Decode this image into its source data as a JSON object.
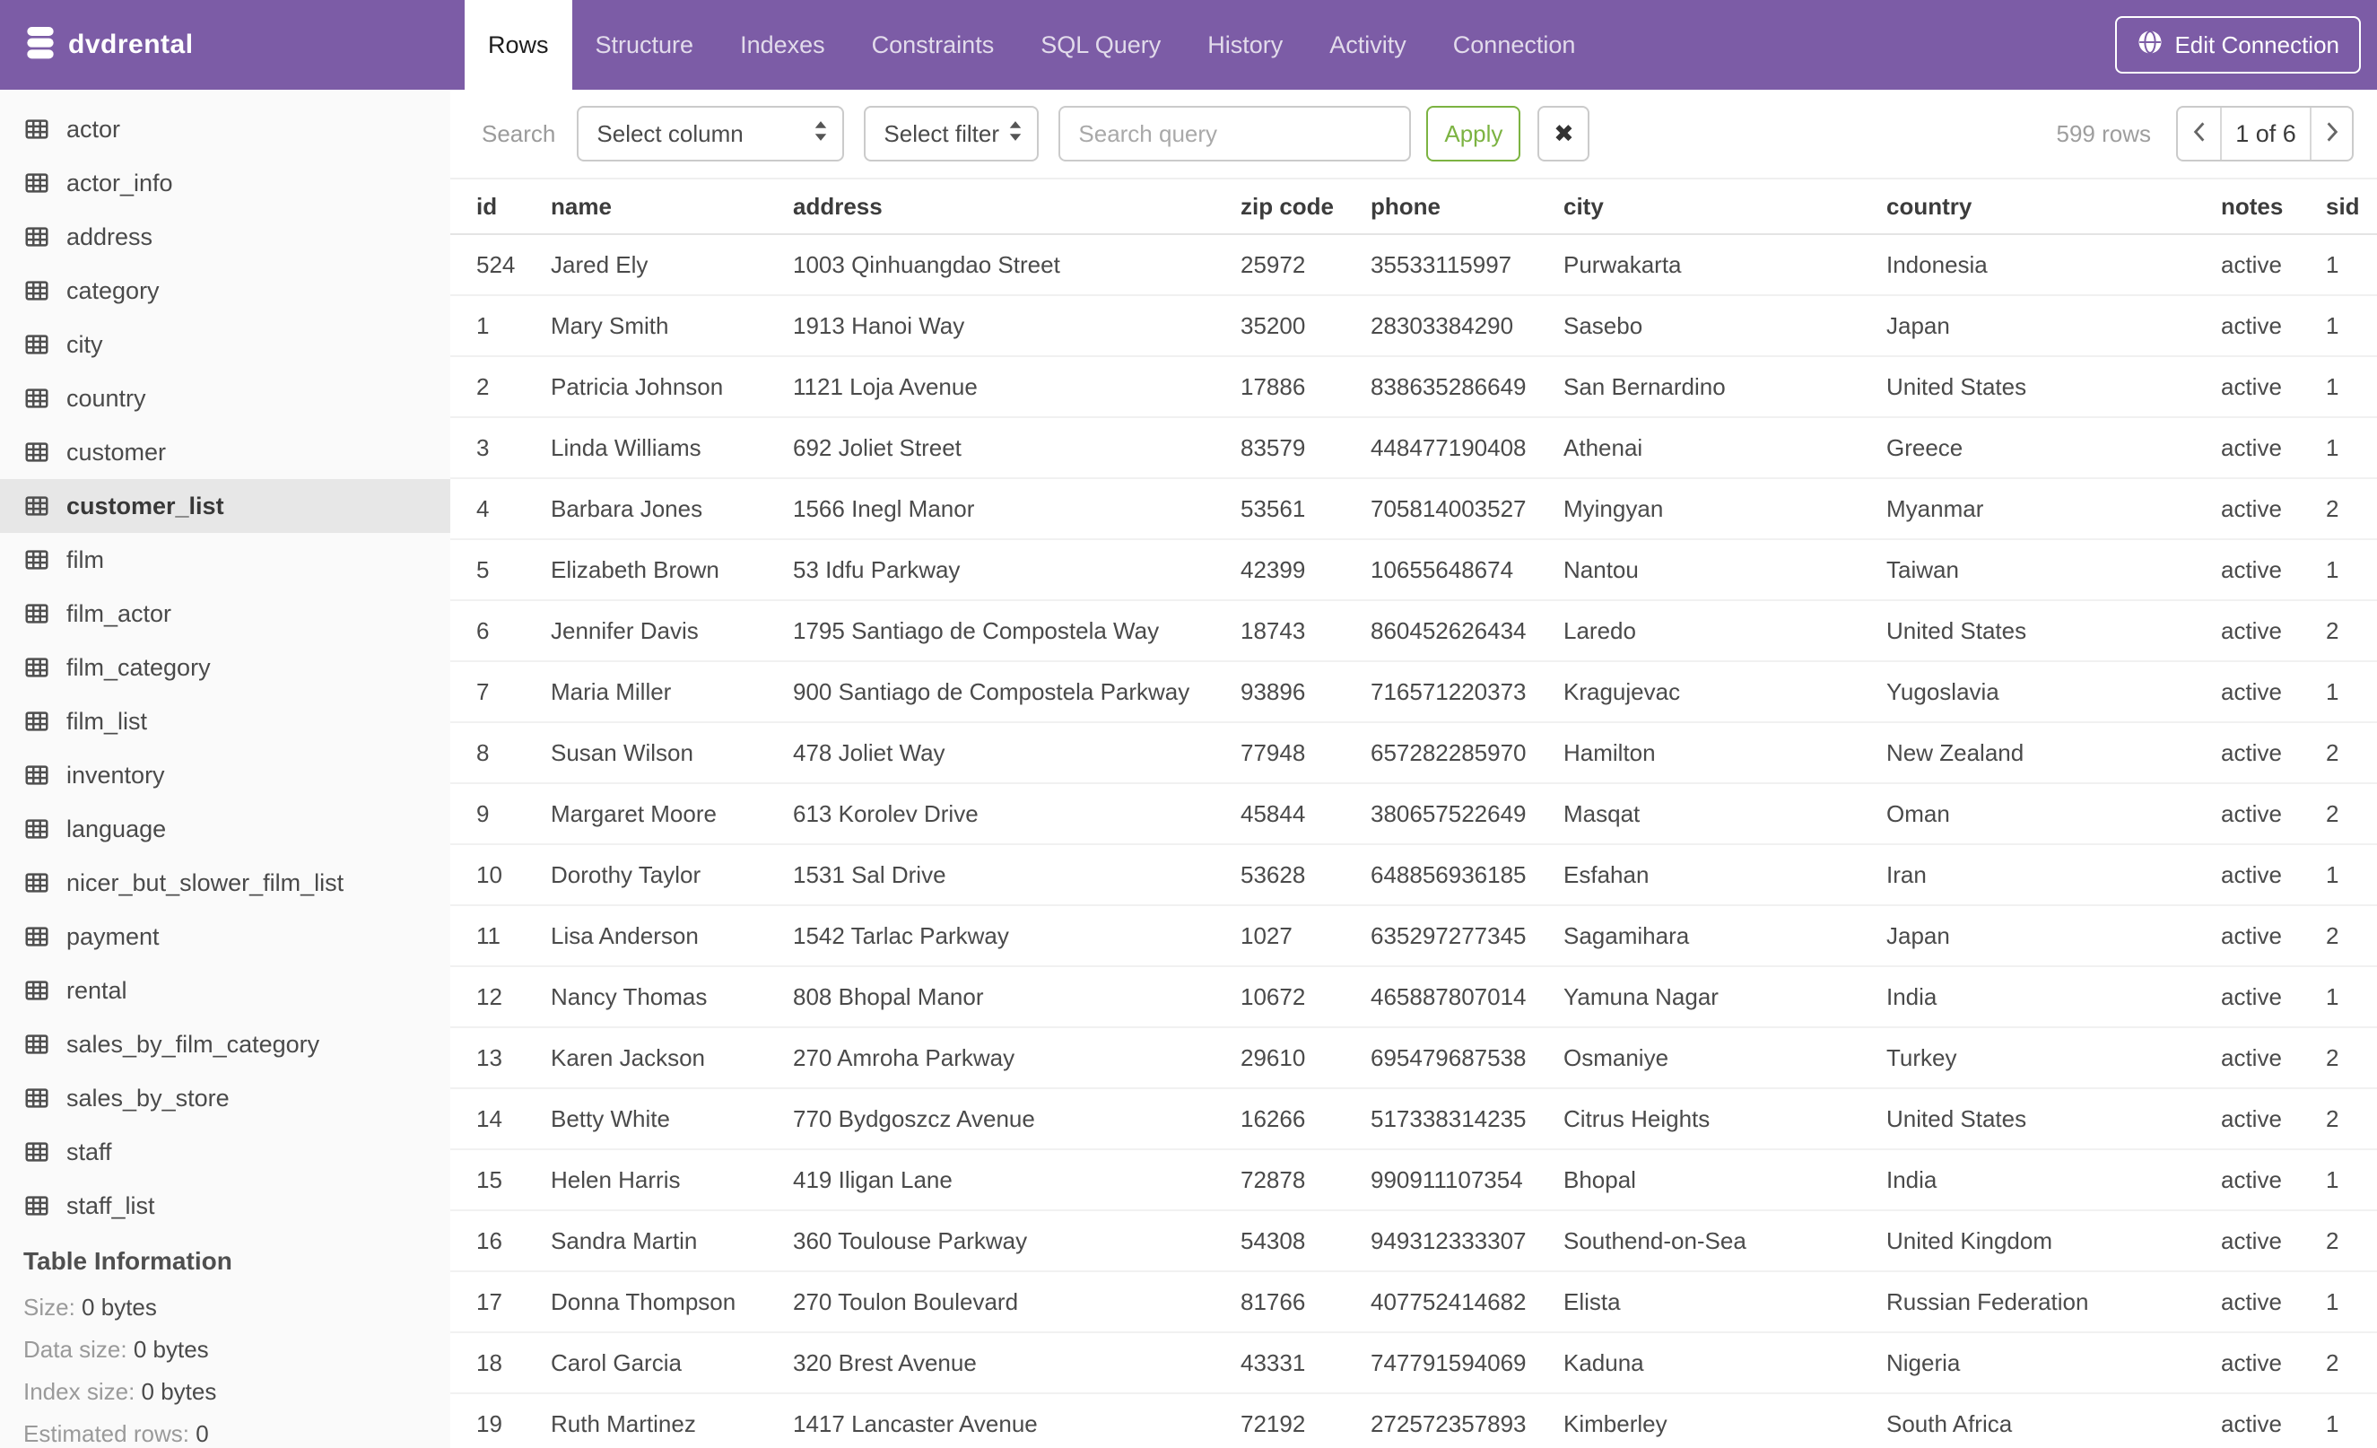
{
  "header": {
    "app_title": "dvdrental",
    "brand_icon": "database-icon",
    "tabs": [
      {
        "label": "Rows",
        "active": true
      },
      {
        "label": "Structure",
        "active": false
      },
      {
        "label": "Indexes",
        "active": false
      },
      {
        "label": "Constraints",
        "active": false
      },
      {
        "label": "SQL Query",
        "active": false
      },
      {
        "label": "History",
        "active": false
      },
      {
        "label": "Activity",
        "active": false
      },
      {
        "label": "Connection",
        "active": false
      }
    ],
    "edit_connection": {
      "label": "Edit Connection",
      "icon": "globe-icon"
    }
  },
  "toolbar": {
    "search_label": "Search",
    "column_select_value": "Select column",
    "column_select_icon": "updown-arrows-icon",
    "filter_select_value": "Select filter",
    "filter_select_icon": "updown-arrows-icon",
    "query_placeholder": "Search query",
    "apply_label": "Apply",
    "clear_label": "✖",
    "rows_count": "599 rows",
    "pagination": {
      "prev_icon": "chevron-left-icon",
      "current_page_label": "1 of 6",
      "next_icon": "chevron-right-icon"
    }
  },
  "sidebar": {
    "item_icon": "table-grid-icon",
    "tables": [
      "actor",
      "actor_info",
      "address",
      "category",
      "city",
      "country",
      "customer",
      "customer_list",
      "film",
      "film_actor",
      "film_category",
      "film_list",
      "inventory",
      "language",
      "nicer_but_slower_film_list",
      "payment",
      "rental",
      "sales_by_film_category",
      "sales_by_store",
      "staff",
      "staff_list"
    ],
    "selected": "customer_list",
    "table_information": {
      "title": "Table Information",
      "rows": [
        {
          "label": "Size:",
          "value": "0 bytes"
        },
        {
          "label": "Data size:",
          "value": "0 bytes"
        },
        {
          "label": "Index size:",
          "value": "0 bytes"
        },
        {
          "label": "Estimated rows:",
          "value": "0"
        }
      ]
    }
  },
  "table": {
    "columns": [
      "id",
      "name",
      "address",
      "zip code",
      "phone",
      "city",
      "country",
      "notes",
      "sid"
    ],
    "rows": [
      [
        524,
        "Jared Ely",
        "1003 Qinhuangdao Street",
        "25972",
        "35533115997",
        "Purwakarta",
        "Indonesia",
        "active",
        1
      ],
      [
        1,
        "Mary Smith",
        "1913 Hanoi Way",
        "35200",
        "28303384290",
        "Sasebo",
        "Japan",
        "active",
        1
      ],
      [
        2,
        "Patricia Johnson",
        "1121 Loja Avenue",
        "17886",
        "838635286649",
        "San Bernardino",
        "United States",
        "active",
        1
      ],
      [
        3,
        "Linda Williams",
        "692 Joliet Street",
        "83579",
        "448477190408",
        "Athenai",
        "Greece",
        "active",
        1
      ],
      [
        4,
        "Barbara Jones",
        "1566 Inegl Manor",
        "53561",
        "705814003527",
        "Myingyan",
        "Myanmar",
        "active",
        2
      ],
      [
        5,
        "Elizabeth Brown",
        "53 Idfu Parkway",
        "42399",
        "10655648674",
        "Nantou",
        "Taiwan",
        "active",
        1
      ],
      [
        6,
        "Jennifer Davis",
        "1795 Santiago de Compostela Way",
        "18743",
        "860452626434",
        "Laredo",
        "United States",
        "active",
        2
      ],
      [
        7,
        "Maria Miller",
        "900 Santiago de Compostela Parkway",
        "93896",
        "716571220373",
        "Kragujevac",
        "Yugoslavia",
        "active",
        1
      ],
      [
        8,
        "Susan Wilson",
        "478 Joliet Way",
        "77948",
        "657282285970",
        "Hamilton",
        "New Zealand",
        "active",
        2
      ],
      [
        9,
        "Margaret Moore",
        "613 Korolev Drive",
        "45844",
        "380657522649",
        "Masqat",
        "Oman",
        "active",
        2
      ],
      [
        10,
        "Dorothy Taylor",
        "1531 Sal Drive",
        "53628",
        "648856936185",
        "Esfahan",
        "Iran",
        "active",
        1
      ],
      [
        11,
        "Lisa Anderson",
        "1542 Tarlac Parkway",
        "1027",
        "635297277345",
        "Sagamihara",
        "Japan",
        "active",
        2
      ],
      [
        12,
        "Nancy Thomas",
        "808 Bhopal Manor",
        "10672",
        "465887807014",
        "Yamuna Nagar",
        "India",
        "active",
        1
      ],
      [
        13,
        "Karen Jackson",
        "270 Amroha Parkway",
        "29610",
        "695479687538",
        "Osmaniye",
        "Turkey",
        "active",
        2
      ],
      [
        14,
        "Betty White",
        "770 Bydgoszcz Avenue",
        "16266",
        "517338314235",
        "Citrus Heights",
        "United States",
        "active",
        2
      ],
      [
        15,
        "Helen Harris",
        "419 Iligan Lane",
        "72878",
        "990911107354",
        "Bhopal",
        "India",
        "active",
        1
      ],
      [
        16,
        "Sandra Martin",
        "360 Toulouse Parkway",
        "54308",
        "949312333307",
        "Southend-on-Sea",
        "United Kingdom",
        "active",
        2
      ],
      [
        17,
        "Donna Thompson",
        "270 Toulon Boulevard",
        "81766",
        "407752414682",
        "Elista",
        "Russian Federation",
        "active",
        1
      ],
      [
        18,
        "Carol Garcia",
        "320 Brest Avenue",
        "43331",
        "747791594069",
        "Kaduna",
        "Nigeria",
        "active",
        2
      ],
      [
        19,
        "Ruth Martinez",
        "1417 Lancaster Avenue",
        "72192",
        "272572357893",
        "Kimberley",
        "South Africa",
        "active",
        1
      ]
    ]
  },
  "colors": {
    "header_purple": "#7C5CA6",
    "apply_green": "#7CB342",
    "sidebar_selected": "#E7E7E7",
    "sidebar_bg": "#FAFAFA"
  }
}
